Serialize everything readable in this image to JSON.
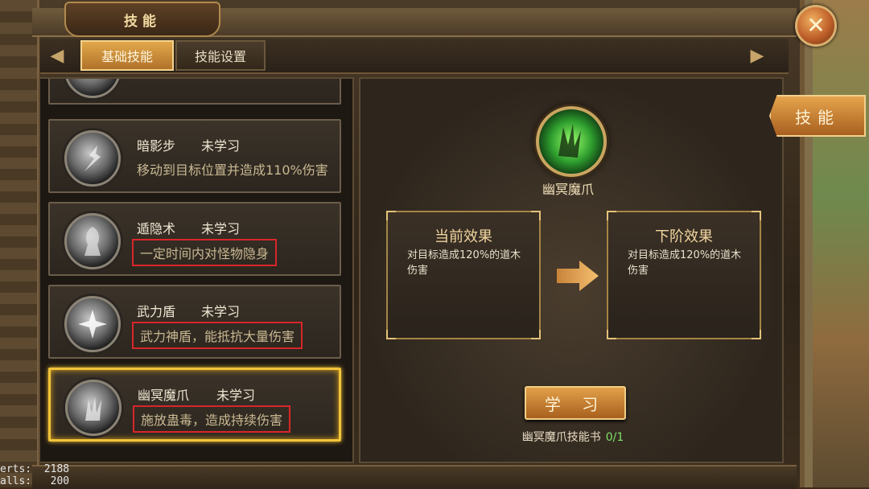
{
  "window": {
    "title": "技能",
    "close_icon": "close-icon"
  },
  "tabs": [
    {
      "label": "基础技能",
      "active": true
    },
    {
      "label": "技能设置",
      "active": false
    }
  ],
  "skills": [
    {
      "name": "暗影步",
      "status": "未学习",
      "desc": "移动到目标位置并造成110%伤害",
      "icon": "shadow-step-icon"
    },
    {
      "name": "遁隐术",
      "status": "未学习",
      "desc": "一定时间内对怪物隐身",
      "icon": "stealth-icon"
    },
    {
      "name": "武力盾",
      "status": "未学习",
      "desc": "武力神盾，能抵抗大量伤害",
      "icon": "shield-icon"
    },
    {
      "name": "幽冥魔爪",
      "status": "未学习",
      "desc": "施放蛊毒，造成持续伤害",
      "icon": "claw-icon",
      "selected": true
    }
  ],
  "detail": {
    "skill_name": "幽冥魔爪",
    "current": {
      "title": "当前效果",
      "text": "对目标造成120%的道木伤害"
    },
    "next": {
      "title": "下阶效果",
      "text": "对目标造成120%的道木伤害"
    },
    "learn_label": "学 习",
    "book_label": "幽冥魔爪技能书",
    "book_count": "0/1"
  },
  "side_tab": {
    "label": "技能"
  },
  "debug": {
    "line1": "erts:  2188",
    "line2": "alls:   200"
  },
  "colors": {
    "accent": "#e2a84a",
    "highlight": "#f1c43a",
    "count": "#7ee06a",
    "warn_box": "#d8262a"
  }
}
